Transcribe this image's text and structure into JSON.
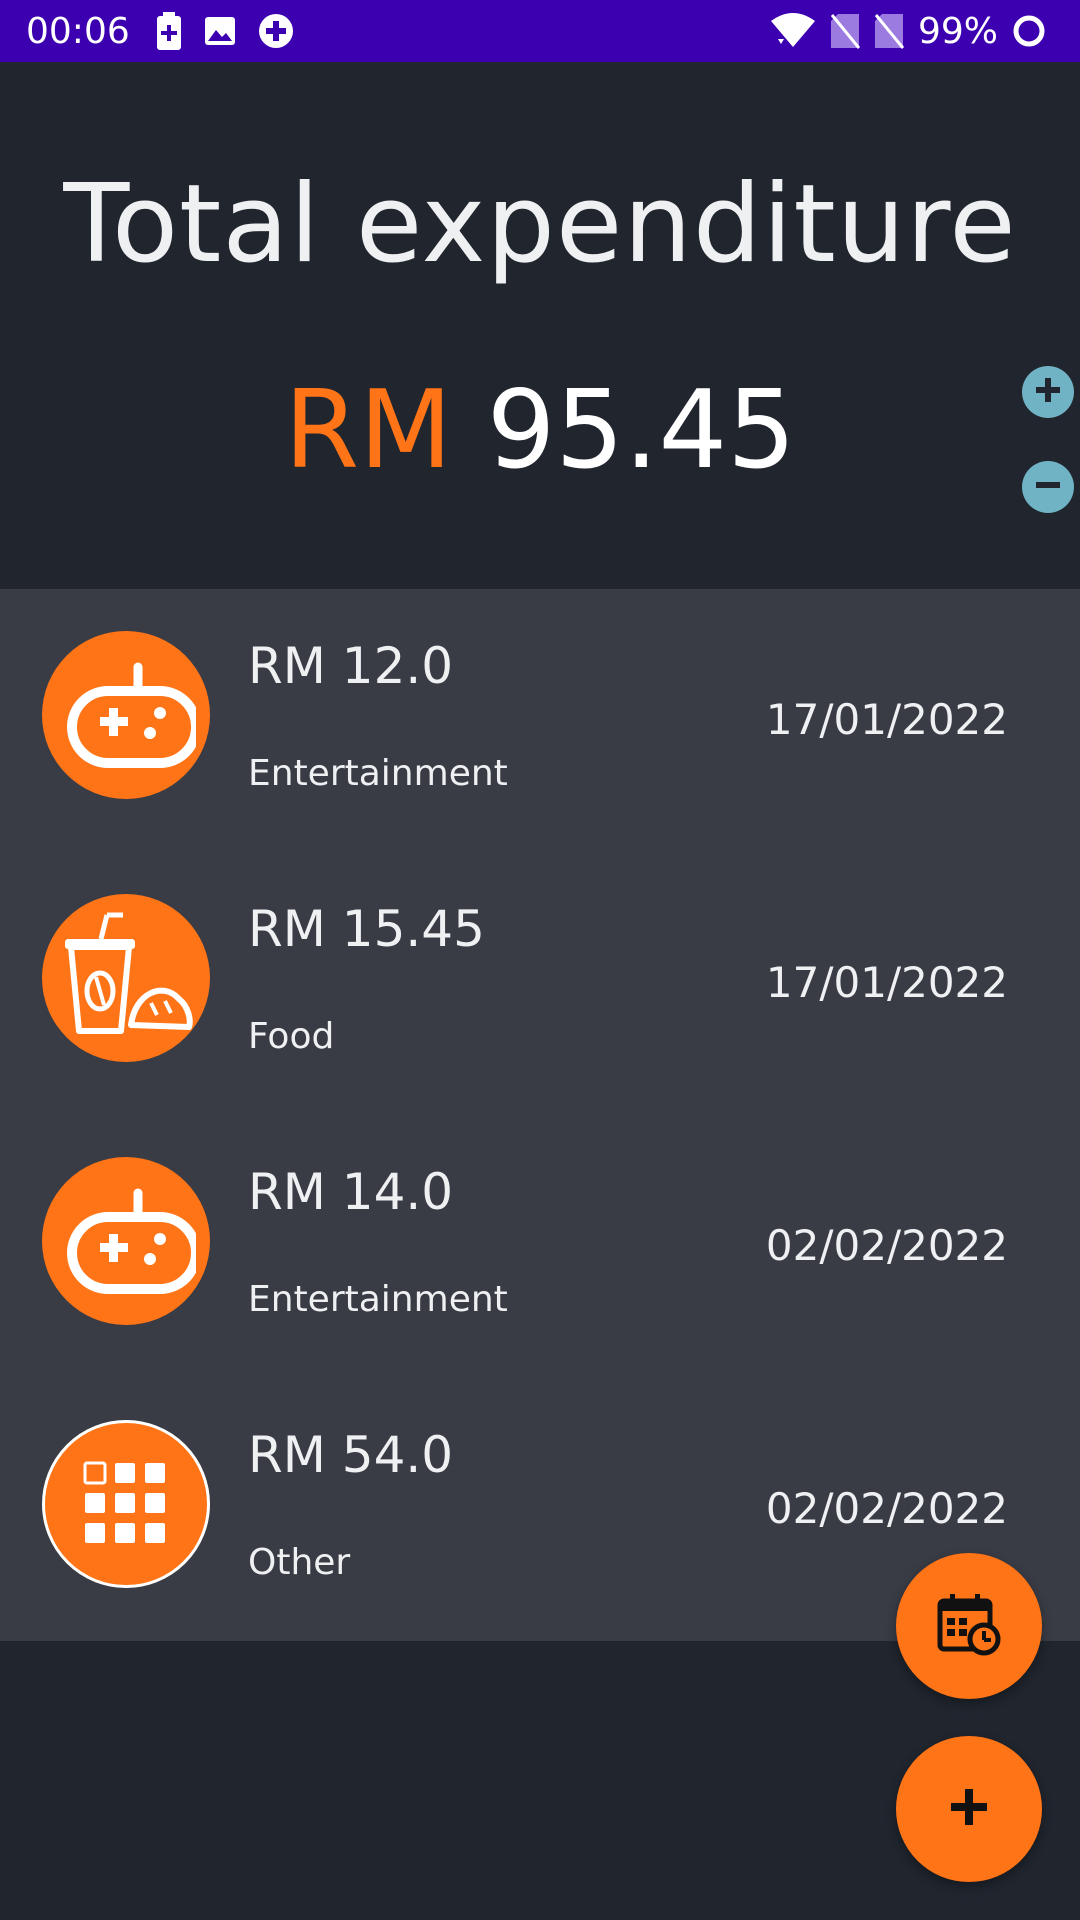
{
  "status_bar": {
    "time": "00:06",
    "battery_percent": "99%",
    "icons_left": [
      "battery-saver-icon",
      "image-icon",
      "plus-circle-icon"
    ],
    "icons_right": [
      "wifi-icon",
      "no-sim-icon",
      "no-sim-icon",
      "battery-ring-icon"
    ]
  },
  "header": {
    "title": "Total expenditure",
    "currency": "RM",
    "total_amount": "95.45"
  },
  "colors": {
    "accent": "#ff7416",
    "status_bar": "#3d00b0",
    "background": "#20252e",
    "list_background": "#393c45",
    "side_button": "#6fb3c4"
  },
  "expenses": [
    {
      "amount": "RM 12.0",
      "category": "Entertainment",
      "date": "17/01/2022",
      "icon": "gamepad-icon"
    },
    {
      "amount": "RM 15.45",
      "category": "Food",
      "date": "17/01/2022",
      "icon": "food-icon"
    },
    {
      "amount": "RM 14.0",
      "category": "Entertainment",
      "date": "02/02/2022",
      "icon": "gamepad-icon"
    },
    {
      "amount": "RM 54.0",
      "category": "Other",
      "date": "02/02/2022",
      "icon": "grid-apps-icon"
    }
  ],
  "actions": {
    "increase_icon": "plus-icon",
    "decrease_icon": "minus-icon",
    "calendar_fab_icon": "calendar-clock-icon",
    "add_fab_icon": "plus-icon"
  }
}
